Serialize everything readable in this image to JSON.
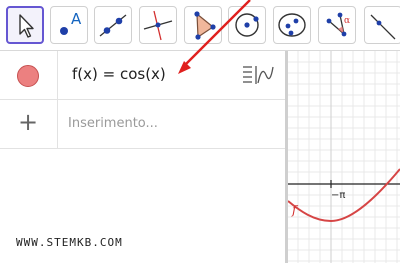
{
  "toolbar": {
    "tools": [
      {
        "name": "move-tool",
        "selected": true
      },
      {
        "name": "point-tool",
        "label": "A"
      },
      {
        "name": "line-tool"
      },
      {
        "name": "perpendicular-line-tool"
      },
      {
        "name": "polygon-tool"
      },
      {
        "name": "circle-center-point-tool"
      },
      {
        "name": "ellipse-tool"
      },
      {
        "name": "angle-tool",
        "label": "α"
      },
      {
        "name": "reflect-tool"
      }
    ]
  },
  "algebra": {
    "entry_1": {
      "expression": "f(x)  =  cos(x)",
      "color": "#ec8080"
    },
    "input": {
      "placeholder": "Inserimento..."
    }
  },
  "graphics": {
    "tick_label": "−π",
    "function_label": "f",
    "curve_color": "#d64545"
  },
  "watermark": "WWW.STEMKB.COM",
  "annotation": {
    "arrow_color": "#e0201e"
  }
}
